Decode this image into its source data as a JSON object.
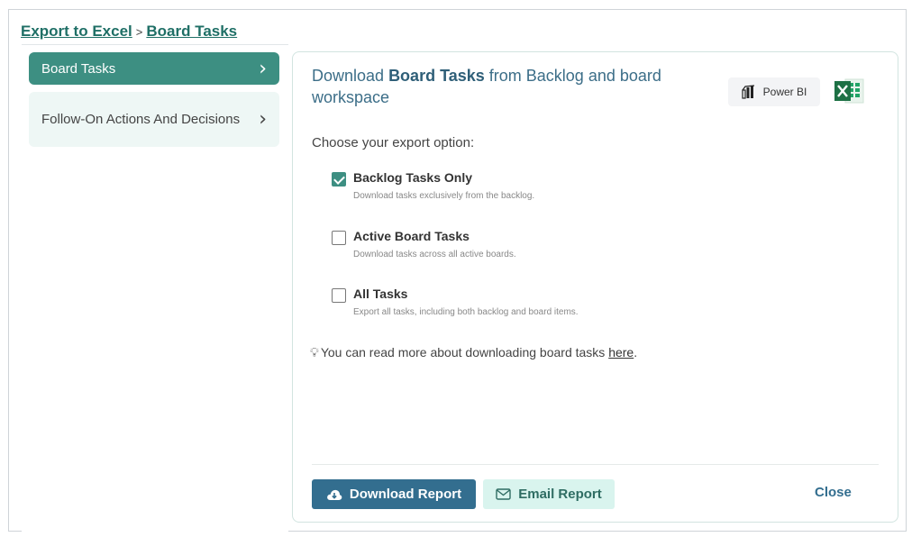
{
  "breadcrumb": {
    "root": "Export to Excel",
    "separator": ">",
    "current": "Board Tasks"
  },
  "sidebar": {
    "items": [
      {
        "label": "Board Tasks",
        "active": true
      },
      {
        "label": "Follow-On Actions And Decisions",
        "active": false
      }
    ]
  },
  "main": {
    "heading_prefix": "Download ",
    "heading_bold": "Board Tasks",
    "heading_suffix": " from Backlog and board workspace",
    "powerbi_label": "Power BI",
    "choose_label": "Choose your export option:",
    "options": [
      {
        "title": "Backlog Tasks Only",
        "description": "Download tasks exclusively from the backlog.",
        "checked": true
      },
      {
        "title": "Active Board Tasks",
        "description": "Download tasks across all active boards.",
        "checked": false
      },
      {
        "title": "All Tasks",
        "description": "Export all tasks, including both backlog and board items.",
        "checked": false
      }
    ],
    "tip_text": "You can read more about downloading board tasks ",
    "tip_link": "here",
    "tip_end": "."
  },
  "footer": {
    "download_label": "Download Report",
    "email_label": "Email Report",
    "close_label": "Close"
  },
  "colors": {
    "accent": "#3d8f82",
    "primary_button": "#336e8f",
    "secondary_button": "#d9f4ee"
  }
}
